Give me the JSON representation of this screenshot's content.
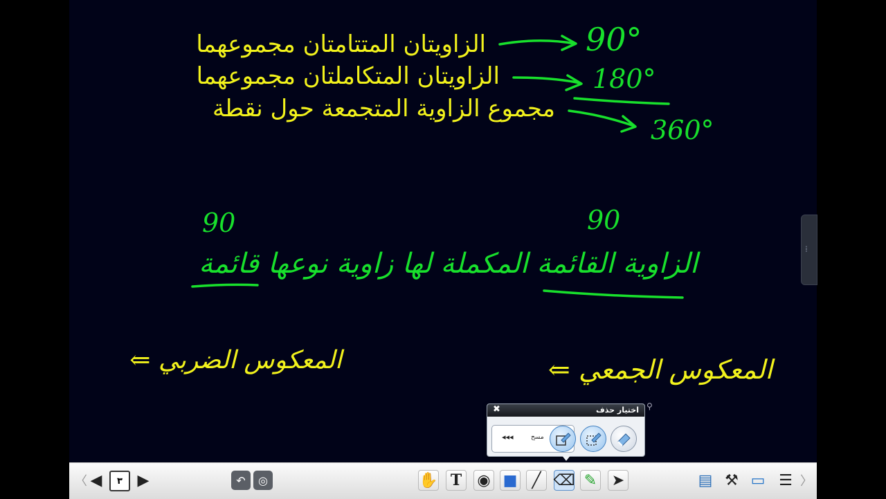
{
  "board": {
    "typed_lines": [
      "الزاويتان المتتامتان مجموعهما",
      "الزاويتان المتكاملتان مجموعهما",
      "مجموع الزاوية المتجمعة حول نقطة"
    ],
    "answers": [
      "90°",
      "180°",
      "360°"
    ],
    "ninety_left": "90",
    "ninety_right": "90",
    "handwritten_sentence": "الزاوية القائمة المكملة لها زاوية نوعها قائمة",
    "left_note": "المعكوس الضربي ⇐",
    "right_note": "المعكوس الجمعي ⇐"
  },
  "eraser_popup": {
    "title": "اختيار حذف",
    "close": "✖",
    "slot_label": "مسح",
    "slot_arrows": "◂◂◂"
  },
  "toolbar": {
    "page_number": "٣",
    "prev": "◀",
    "next": "▶"
  },
  "colors": {
    "board": "#010318",
    "typed_text": "#f2f21c",
    "ink_green": "#18e02c",
    "ink_yellow": "#f2f21c"
  }
}
